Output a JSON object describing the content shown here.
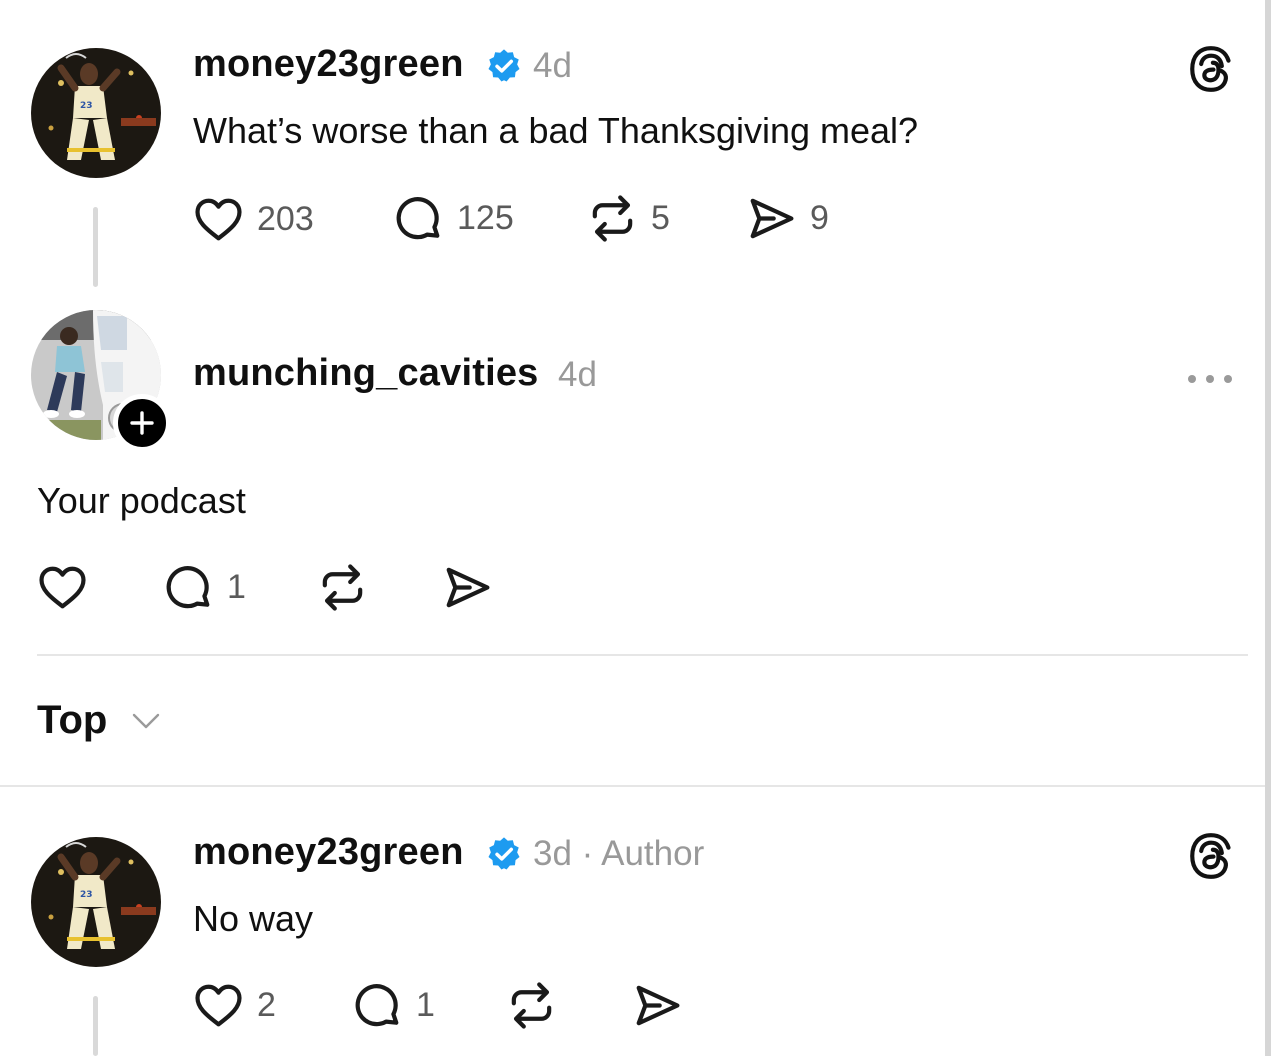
{
  "posts": [
    {
      "username": "money23green",
      "verified": true,
      "time": "4d",
      "text": "What’s worse than a bad Thanksgiving meal?",
      "counts": {
        "likes": "203",
        "replies": "125",
        "reposts": "5",
        "shares": "9"
      }
    },
    {
      "username": "munching_cavities",
      "verified": false,
      "time": "4d",
      "text": "Your podcast",
      "counts": {
        "replies": "1"
      }
    },
    {
      "username": "money23green",
      "verified": true,
      "time": "3d · Author",
      "text": "No way",
      "counts": {
        "likes": "2",
        "replies": "1"
      }
    }
  ],
  "sort": {
    "label": "Top"
  },
  "icons": {
    "like": "heart-icon",
    "reply": "comment-icon",
    "repost": "repost-icon",
    "share": "send-icon",
    "verified": "verified-badge-icon",
    "app": "threads-logo-icon",
    "more": "more-icon",
    "follow": "plus-icon",
    "sort": "chevron-down-icon"
  },
  "colors": {
    "verified": "#1d9bf0",
    "text": "#101010",
    "muted": "#999999"
  }
}
